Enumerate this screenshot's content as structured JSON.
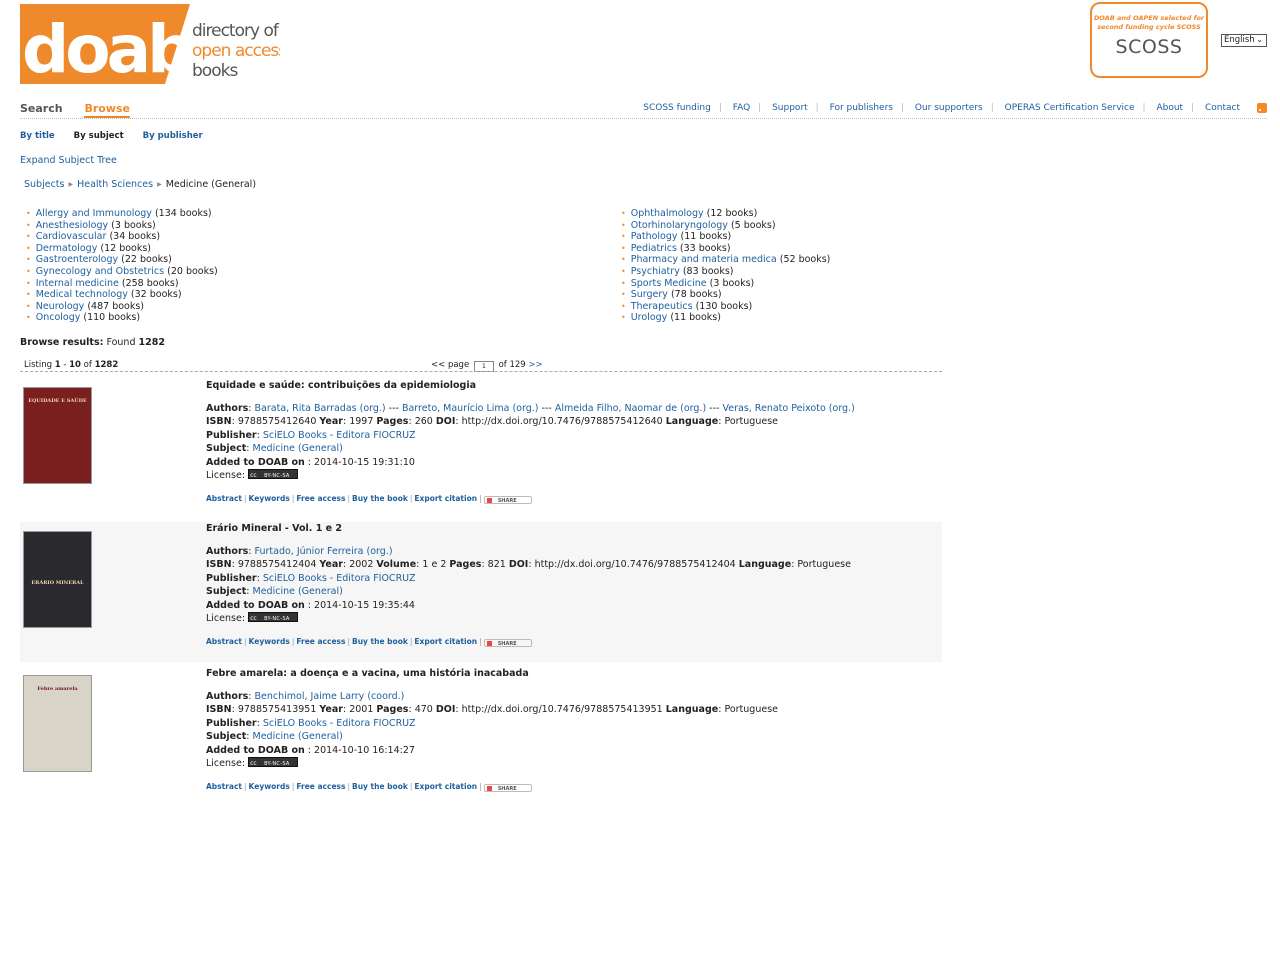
{
  "header": {
    "logo_text": "doab",
    "logo_sub": [
      "directory of",
      "open access",
      "books"
    ],
    "scoss_text": "DOAB and OAPEN selected for second funding cycle SCOSS",
    "scoss_logo": "SCOSS",
    "language": "English"
  },
  "main_nav": {
    "search": "Search",
    "browse": "Browse"
  },
  "top_links": [
    "SCOSS funding",
    "FAQ",
    "Support",
    "For publishers",
    "Our supporters",
    "OPERAS Certification Service",
    "About",
    "Contact"
  ],
  "sub_nav": {
    "by_title": "By title",
    "by_subject": "By subject",
    "by_publisher": "By publisher"
  },
  "expand_label": "Expand Subject Tree",
  "breadcrumb": [
    "Subjects",
    "Health Sciences",
    "Medicine (General)"
  ],
  "subjects_left": [
    {
      "name": "Allergy and Immunology",
      "count": "(134 books)"
    },
    {
      "name": "Anesthesiology",
      "count": "(3 books)"
    },
    {
      "name": "Cardiovascular",
      "count": "(34 books)"
    },
    {
      "name": "Dermatology",
      "count": "(12 books)"
    },
    {
      "name": "Gastroenterology",
      "count": "(22 books)"
    },
    {
      "name": "Gynecology and Obstetrics",
      "count": "(20 books)"
    },
    {
      "name": "Internal medicine",
      "count": "(258 books)"
    },
    {
      "name": "Medical technology",
      "count": "(32 books)"
    },
    {
      "name": "Neurology",
      "count": "(487 books)"
    },
    {
      "name": "Oncology",
      "count": "(110 books)"
    }
  ],
  "subjects_right": [
    {
      "name": "Ophthalmology",
      "count": "(12 books)"
    },
    {
      "name": "Otorhinolaryngology",
      "count": "(5 books)"
    },
    {
      "name": "Pathology",
      "count": "(11 books)"
    },
    {
      "name": "Pediatrics",
      "count": "(33 books)"
    },
    {
      "name": "Pharmacy and materia medica",
      "count": "(52 books)"
    },
    {
      "name": "Psychiatry",
      "count": "(83 books)"
    },
    {
      "name": "Sports Medicine",
      "count": "(3 books)"
    },
    {
      "name": "Surgery",
      "count": "(78 books)"
    },
    {
      "name": "Therapeutics",
      "count": "(130 books)"
    },
    {
      "name": "Urology",
      "count": "(11 books)"
    }
  ],
  "results": {
    "label": "Browse results:",
    "found": "Found",
    "total": "1282",
    "listing": "Listing",
    "from": "1",
    "to": "10",
    "of": "of",
    "page_prev": "<<",
    "page_word": "page",
    "page_num": "1",
    "page_of": "of 129",
    "page_next": ">>"
  },
  "labels": {
    "authors": "Authors",
    "isbn": "ISBN",
    "year": "Year",
    "volume": "Volume",
    "pages": "Pages",
    "doi": "DOI",
    "language": "Language",
    "publisher": "Publisher",
    "subject": "Subject",
    "added": "Added to DOAB on",
    "license": "License:",
    "abstract": "Abstract",
    "keywords": "Keywords",
    "free_access": "Free access",
    "buy": "Buy the book",
    "export": "Export citation",
    "share": "SHARE"
  },
  "books": [
    {
      "title": "Equidade e saúde: contribuições da epidemiologia",
      "authors": [
        "Barata, Rita Barradas (org.)",
        "Barreto, Maurício Lima (org.)",
        "Almeida Filho, Naomar de (org.)",
        "Veras, Renato Peixoto (org.)"
      ],
      "isbn": "9788575412640",
      "year": "1997",
      "pages": "260",
      "doi": "http://dx.doi.org/10.7476/9788575412640",
      "language": "Portuguese",
      "publisher": "SciELO Books - Editora FIOCRUZ",
      "subject": "Medicine (General)",
      "added": "2014-10-15 19:31:10",
      "cover_text": "EQUIDADE E SAÚDE",
      "cover_color": "#7a1f1f"
    },
    {
      "title": "Erário Mineral - Vol. 1 e 2",
      "authors": [
        "Furtado, Júnior Ferreira (org.)"
      ],
      "isbn": "9788575412404",
      "year": "2002",
      "volume": "1 e 2",
      "pages": "821",
      "doi": "http://dx.doi.org/10.7476/9788575412404",
      "language": "Portuguese",
      "publisher": "SciELO Books - Editora FIOCRUZ",
      "subject": "Medicine (General)",
      "added": "2014-10-15 19:35:44",
      "cover_text": "ERÁRIO MINERAL",
      "cover_color": "#2a2a2e"
    },
    {
      "title": "Febre amarela: a doença e a vacina, uma história inacabada",
      "authors": [
        "Benchimol, Jaime Larry (coord.)"
      ],
      "isbn": "9788575413951",
      "year": "2001",
      "pages": "470",
      "doi": "http://dx.doi.org/10.7476/9788575413951",
      "language": "Portuguese",
      "publisher": "SciELO Books - Editora FIOCRUZ",
      "subject": "Medicine (General)",
      "added": "2014-10-10 16:14:27",
      "cover_text": "Febre amarela",
      "cover_color": "#d9d4c8"
    }
  ],
  "colors": {
    "accent": "#ef8a2c",
    "link": "#1f5f9e"
  }
}
